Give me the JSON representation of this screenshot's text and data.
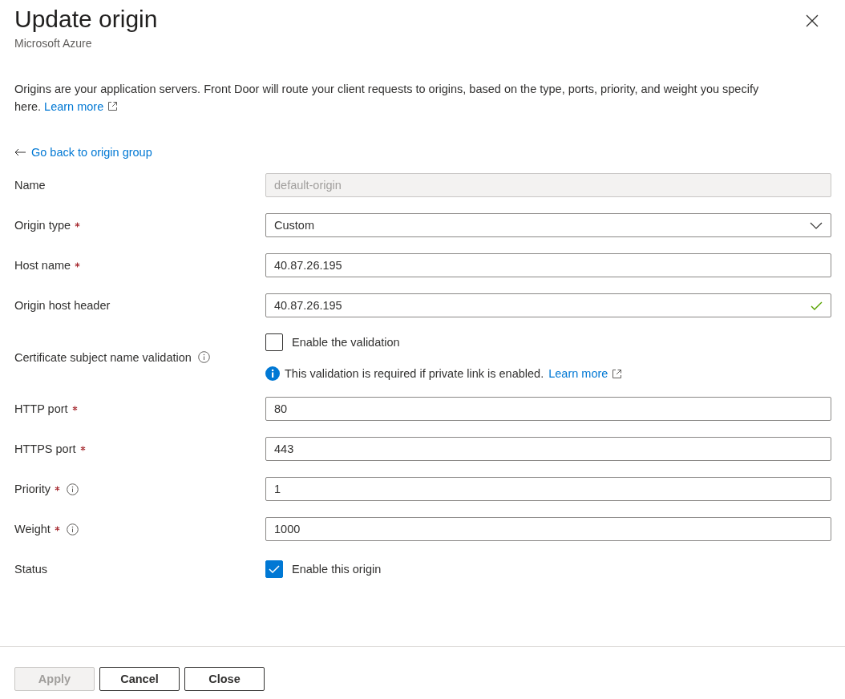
{
  "panel": {
    "title": "Update origin",
    "subtitle": "Microsoft Azure"
  },
  "description": {
    "text": "Origins are your application servers. Front Door will route your client requests to origins, based on the type, ports, priority, and weight you specify here.",
    "link": "Learn more"
  },
  "back_link": "Go back to origin group",
  "fields": [
    {
      "kind": "text",
      "label": "Name",
      "required": false,
      "info": false,
      "value": "default-origin",
      "disabled": true,
      "valid": false
    },
    {
      "kind": "select",
      "label": "Origin type",
      "required": true,
      "info": false,
      "value": "Custom",
      "disabled": false,
      "valid": false
    },
    {
      "kind": "text",
      "label": "Host name",
      "required": true,
      "info": false,
      "value": "40.87.26.195",
      "disabled": false,
      "valid": false
    },
    {
      "kind": "text",
      "label": "Origin host header",
      "required": false,
      "info": false,
      "value": "40.87.26.195",
      "disabled": false,
      "valid": true
    },
    {
      "kind": "checkbox",
      "label": "Certificate subject name validation",
      "required": false,
      "info": true,
      "option": "Enable the validation",
      "checked": false,
      "note": {
        "text": "This validation is required if private link is enabled.",
        "link": "Learn more"
      }
    },
    {
      "kind": "text",
      "label": "HTTP port",
      "required": true,
      "info": false,
      "value": "80",
      "disabled": false,
      "valid": false
    },
    {
      "kind": "text",
      "label": "HTTPS port",
      "required": true,
      "info": false,
      "value": "443",
      "disabled": false,
      "valid": false
    },
    {
      "kind": "text",
      "label": "Priority",
      "required": true,
      "info": true,
      "value": "1",
      "disabled": false,
      "valid": false
    },
    {
      "kind": "text",
      "label": "Weight",
      "required": true,
      "info": true,
      "value": "1000",
      "disabled": false,
      "valid": false
    },
    {
      "kind": "checkbox",
      "label": "Status",
      "required": false,
      "info": false,
      "option": "Enable this origin",
      "checked": true
    }
  ],
  "buttons": [
    {
      "label": "Apply",
      "disabled": true
    },
    {
      "label": "Cancel",
      "disabled": false
    },
    {
      "label": "Close",
      "disabled": false
    }
  ]
}
